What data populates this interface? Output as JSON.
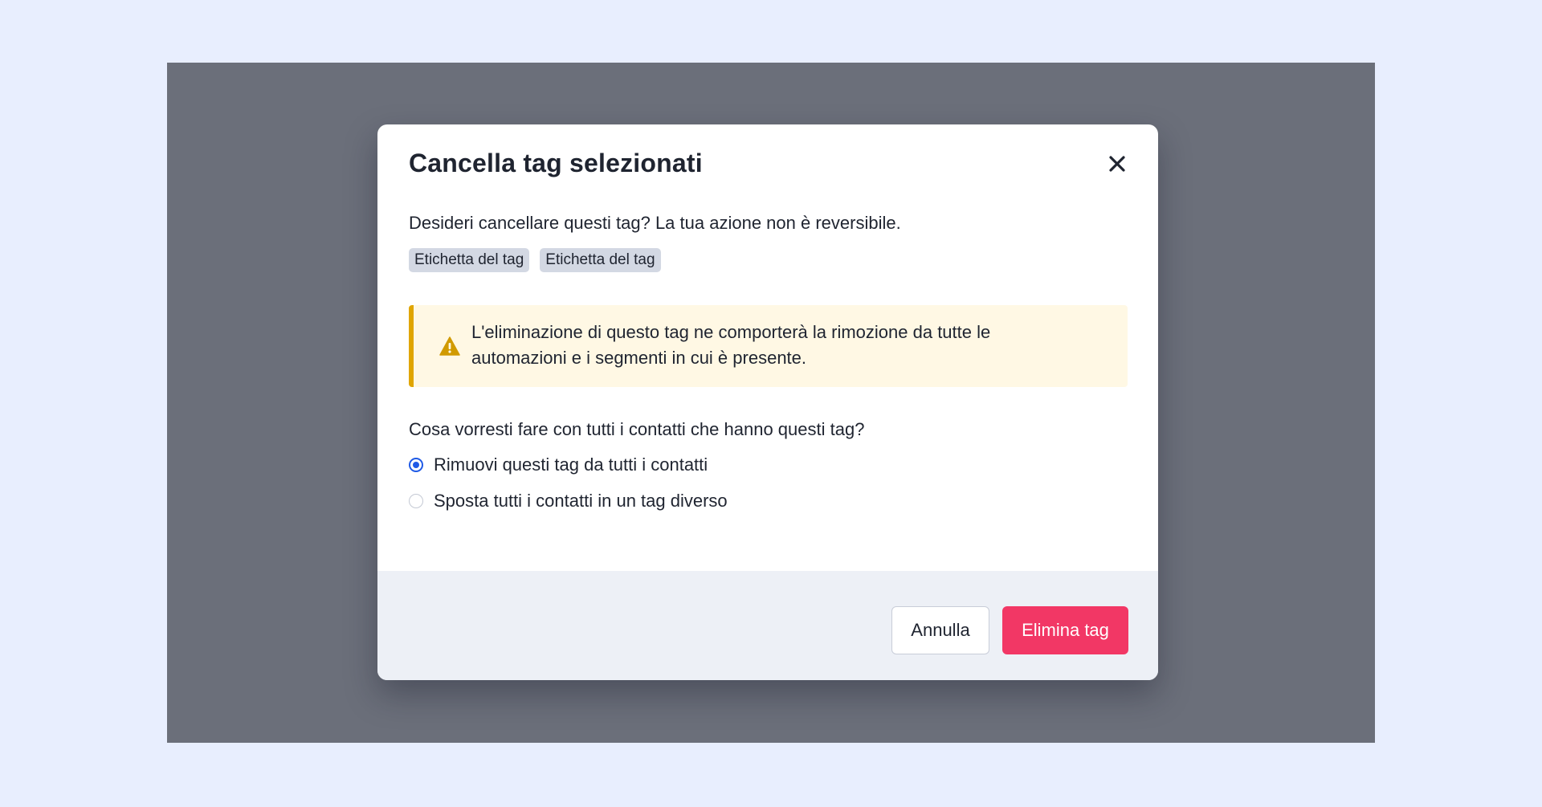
{
  "modal": {
    "title": "Cancella tag selezionati",
    "description": "Desideri cancellare questi tag? La tua azione non è reversibile.",
    "tags": [
      "Etichetta del tag",
      "Etichetta del tag"
    ],
    "warning": {
      "icon": "warning-triangle-icon",
      "text": "L'eliminazione di questo tag ne comporterà la rimozione da tutte le automazioni e i segmenti in cui è presente."
    },
    "question": "Cosa vorresti fare con tutti i contatti che hanno questi tag?",
    "options": [
      {
        "label": "Rimuovi questi tag da tutti i contatti",
        "selected": true
      },
      {
        "label": "Sposta tutti i contatti in un tag diverso",
        "selected": false
      }
    ],
    "close_icon": "close-icon"
  },
  "footer": {
    "cancel_label": "Annulla",
    "delete_label": "Elimina tag"
  },
  "colors": {
    "page_background": "#E8EEFE",
    "overlay": "#6B6F7A",
    "primary": "#1F5AE6",
    "danger": "#F23765",
    "warning_accent": "#E0A500",
    "warning_background": "#FFF8E4",
    "tag_background": "#D3D8E3",
    "footer_background": "#EDF0F6"
  }
}
